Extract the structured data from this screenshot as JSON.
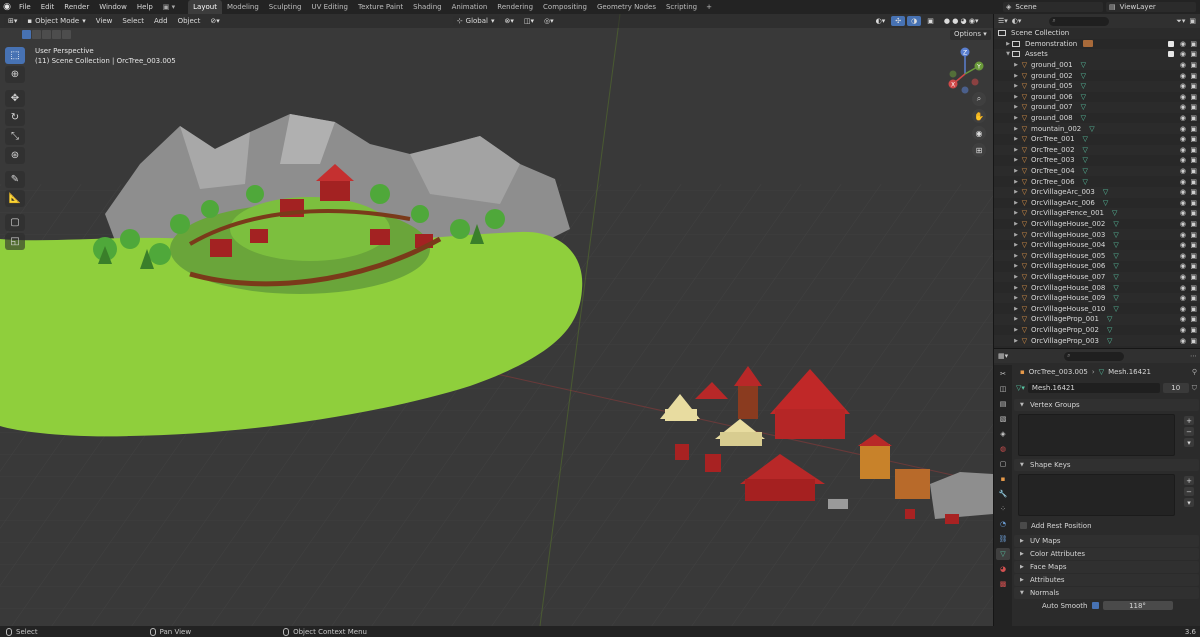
{
  "topbar": {
    "menus": [
      "File",
      "Edit",
      "Render",
      "Window",
      "Help"
    ],
    "workspaces": [
      "Layout",
      "Modeling",
      "Sculpting",
      "UV Editing",
      "Texture Paint",
      "Shading",
      "Animation",
      "Rendering",
      "Compositing",
      "Geometry Nodes",
      "Scripting"
    ],
    "active_workspace": "Layout",
    "add_tab": "+",
    "scene": "Scene",
    "view_layer": "ViewLayer"
  },
  "viewport": {
    "mode": "Object Mode",
    "menus": [
      "View",
      "Select",
      "Add",
      "Object"
    ],
    "transform_orientation": "Global",
    "options_label": "Options",
    "info_line1": "User Perspective",
    "info_line2": "(11) Scene Collection | OrcTree_003.005",
    "gizmo_labels": {
      "z": "Z",
      "y": "Y",
      "x": "X"
    }
  },
  "outliner": {
    "search_placeholder": "",
    "root": "Scene Collection",
    "collections": [
      {
        "label": "Demonstration"
      },
      {
        "label": "Assets"
      }
    ],
    "items": [
      "ground_001",
      "ground_002",
      "ground_005",
      "ground_006",
      "ground_007",
      "ground_008",
      "mountain_002",
      "OrcTree_001",
      "OrcTree_002",
      "OrcTree_003",
      "OrcTree_004",
      "OrcTree_006",
      "OrcVillageArc_003",
      "OrcVillageArc_006",
      "OrcVillageFence_001",
      "OrcVillageHouse_002",
      "OrcVillageHouse_003",
      "OrcVillageHouse_004",
      "OrcVillageHouse_005",
      "OrcVillageHouse_006",
      "OrcVillageHouse_007",
      "OrcVillageHouse_008",
      "OrcVillageHouse_009",
      "OrcVillageHouse_010",
      "OrcVillageProp_001",
      "OrcVillageProp_002",
      "OrcVillageProp_003"
    ]
  },
  "properties": {
    "breadcrumb_object": "OrcTree_003.005",
    "breadcrumb_mesh": "Mesh.16421",
    "mesh_name": "Mesh.16421",
    "mesh_users": "10",
    "panels": {
      "vertex_groups": "Vertex Groups",
      "shape_keys": "Shape Keys",
      "add_rest_position": "Add Rest Position",
      "uv_maps": "UV Maps",
      "color_attributes": "Color Attributes",
      "face_maps": "Face Maps",
      "attributes": "Attributes",
      "normals": "Normals",
      "auto_smooth": "Auto Smooth",
      "auto_smooth_angle": "118°"
    }
  },
  "statusbar": {
    "select": "Select",
    "pan_view": "Pan View",
    "context_menu": "Object Context Menu",
    "version": "3.6"
  },
  "colors": {
    "accent": "#4772b3",
    "ground_green": "#8fcf3c",
    "object_orange": "#e79a4a",
    "mesh_teal": "#59c7a5"
  }
}
